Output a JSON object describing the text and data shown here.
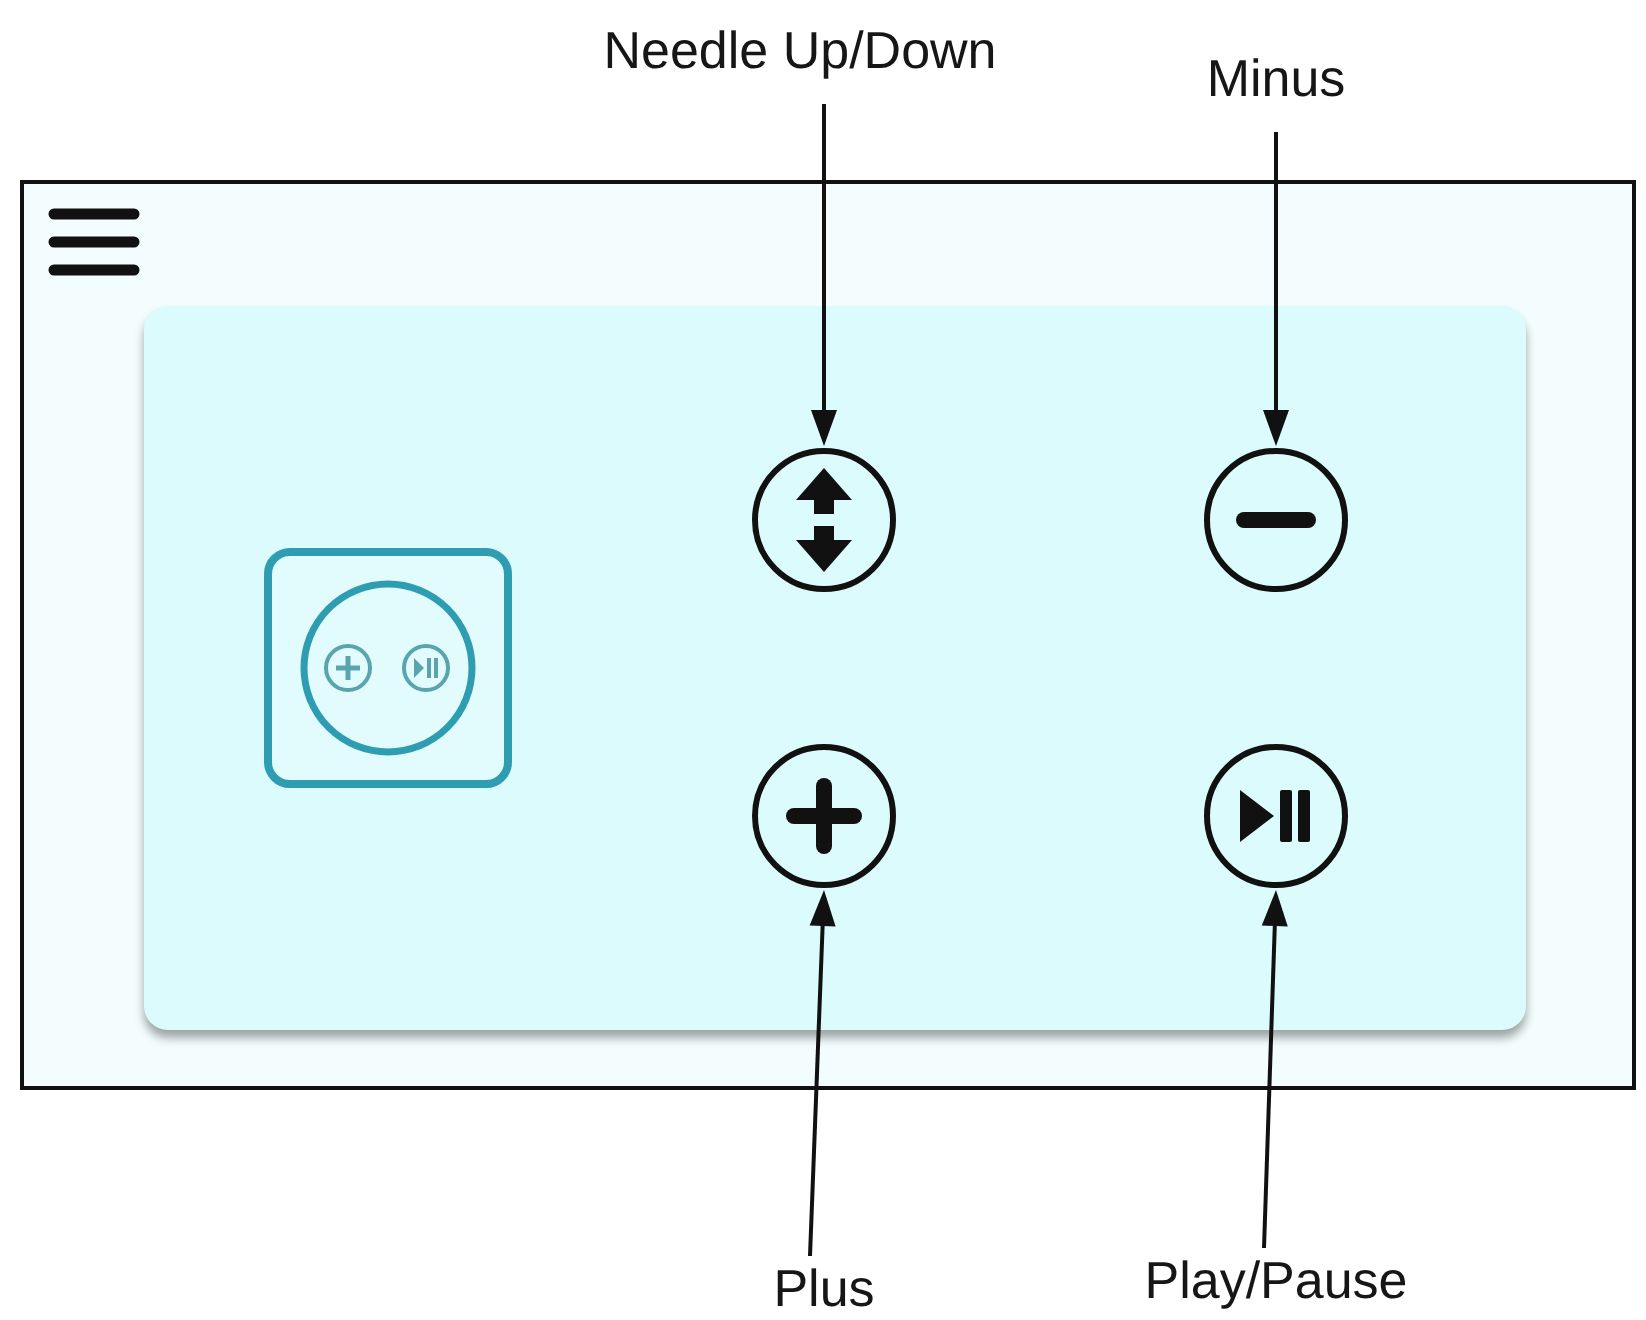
{
  "panel": {
    "buttons": [
      {
        "kind": "up_down",
        "callout": "Needle Up/Down"
      },
      {
        "kind": "minus",
        "callout": "Minus"
      },
      {
        "kind": "plus",
        "callout": "Plus"
      },
      {
        "kind": "play_pause",
        "callout": "Play/Pause"
      }
    ]
  }
}
